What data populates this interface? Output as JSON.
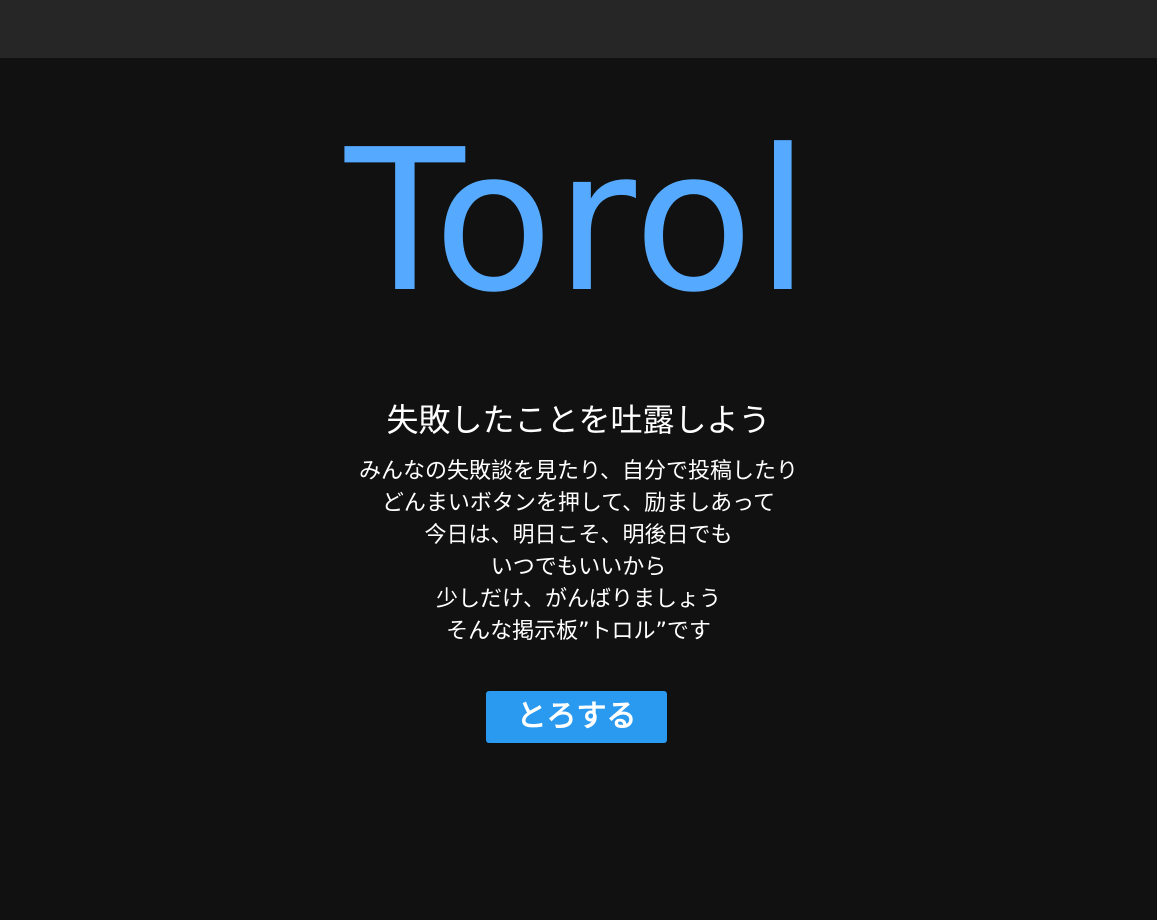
{
  "brand": {
    "logo_text": "Torol",
    "accent_color": "#55aaff"
  },
  "hero": {
    "headline": "失敗したことを吐露しよう",
    "lines": [
      "みんなの失敗談を見たり、自分で投稿したり",
      "どんまいボタンを押して、励ましあって",
      "今日は、明日こそ、明後日でも",
      "いつでもいいから",
      "少しだけ、がんばりましょう",
      "そんな掲示板”トロル”です"
    ],
    "cta_label": "とろする",
    "cta_color": "#2a9af0"
  },
  "theme": {
    "page_background": "#111111",
    "top_bar_background": "#262626"
  }
}
